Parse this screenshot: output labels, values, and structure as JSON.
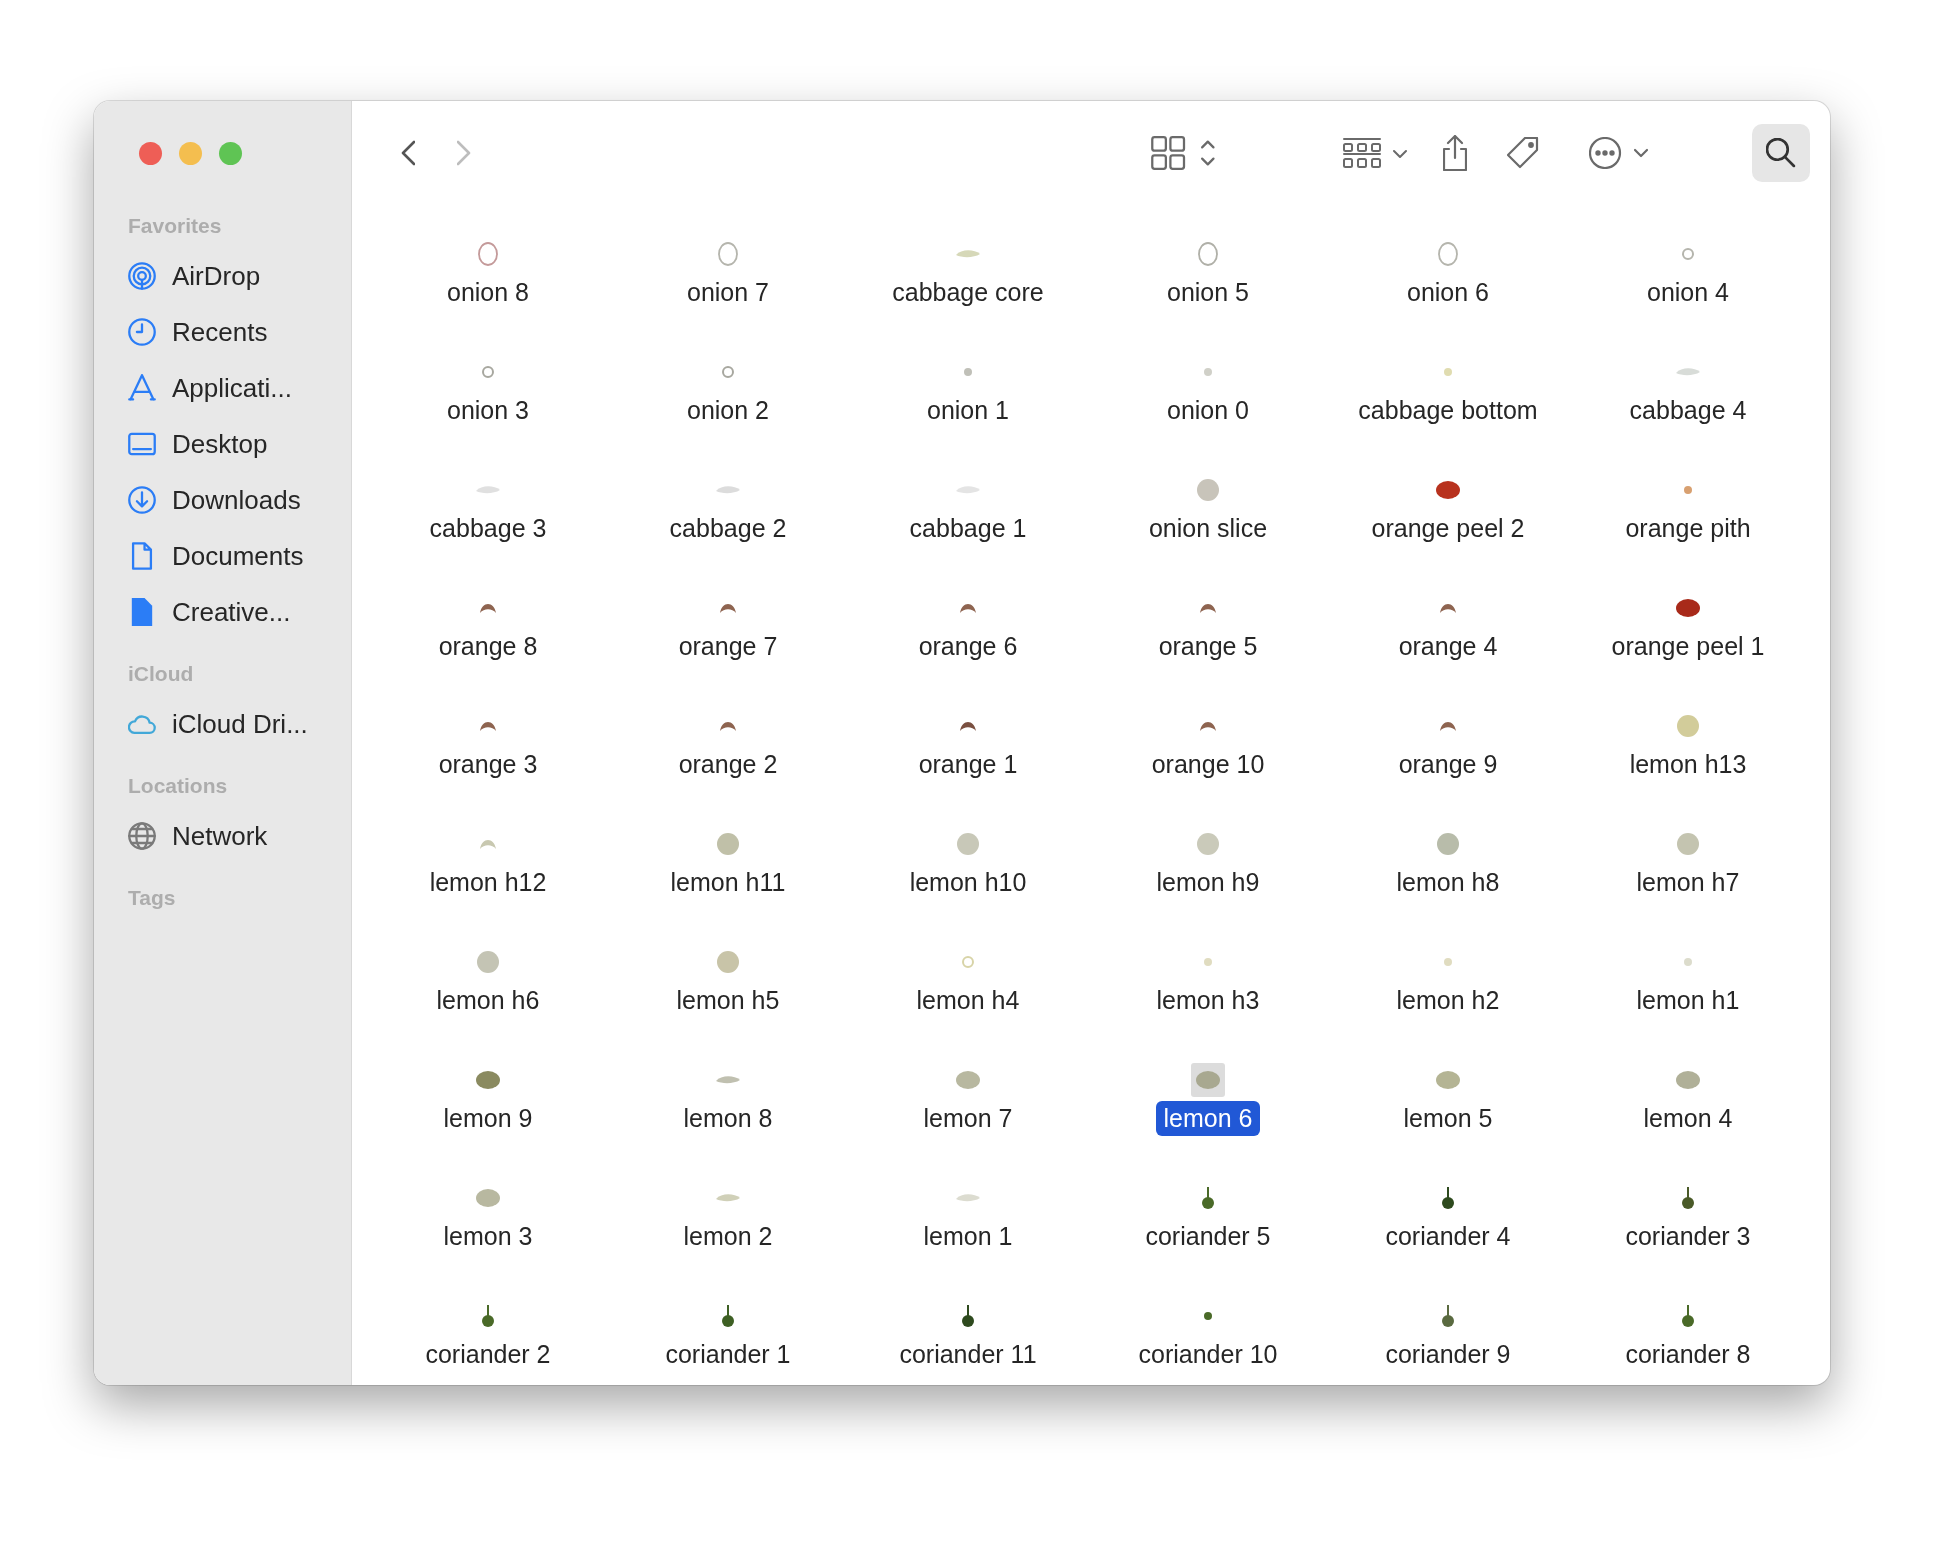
{
  "toolbar": {
    "back": {
      "disabled": false
    },
    "forward": {
      "disabled": true
    }
  },
  "sidebar": {
    "sections": [
      {
        "title": "Favorites",
        "items": [
          {
            "label": "AirDrop",
            "kind": "airdrop"
          },
          {
            "label": "Recents",
            "kind": "clock"
          },
          {
            "label": "Applicati...",
            "kind": "apps"
          },
          {
            "label": "Desktop",
            "kind": "desktop"
          },
          {
            "label": "Downloads",
            "kind": "download"
          },
          {
            "label": "Documents",
            "kind": "document"
          },
          {
            "label": "Creative...",
            "kind": "filled"
          }
        ]
      },
      {
        "title": "iCloud",
        "items": [
          {
            "label": "iCloud Dri...",
            "kind": "cloud"
          }
        ]
      },
      {
        "title": "Locations",
        "items": [
          {
            "label": "Network",
            "kind": "globe"
          }
        ]
      },
      {
        "title": "Tags"
      }
    ]
  },
  "files": [
    {
      "name": "onion 8",
      "kind": "ring",
      "color": "#c49a9a",
      "selected": false
    },
    {
      "name": "onion 7",
      "kind": "ring",
      "color": "#b5b5ad",
      "selected": false
    },
    {
      "name": "cabbage core",
      "kind": "sliver",
      "color": "#d6d8b8",
      "selected": false
    },
    {
      "name": "onion 5",
      "kind": "ring",
      "color": "#b0b0a8",
      "selected": false
    },
    {
      "name": "onion 6",
      "kind": "ring",
      "color": "#b5b5ad",
      "selected": false
    },
    {
      "name": "onion 4",
      "kind": "small",
      "color": "#b5b5ad",
      "selected": false
    },
    {
      "name": "onion 3",
      "kind": "small",
      "color": "#a8a8a0",
      "selected": false
    },
    {
      "name": "onion 2",
      "kind": "small",
      "color": "#a8a8a0",
      "selected": false
    },
    {
      "name": "onion 1",
      "kind": "dot",
      "color": "#c0c0b8",
      "selected": false
    },
    {
      "name": "onion 0",
      "kind": "dot",
      "color": "#d0d0c8",
      "selected": false
    },
    {
      "name": "cabbage bottom",
      "kind": "dot",
      "color": "#e0dcb0",
      "selected": false
    },
    {
      "name": "cabbage 4",
      "kind": "sliver",
      "color": "#d8dcd8",
      "selected": false
    },
    {
      "name": "cabbage 3",
      "kind": "sliver",
      "color": "#e0e0e0",
      "selected": false
    },
    {
      "name": "cabbage 2",
      "kind": "sliver",
      "color": "#dcdcdc",
      "selected": false
    },
    {
      "name": "cabbage 1",
      "kind": "sliver",
      "color": "#e4e4e4",
      "selected": false
    },
    {
      "name": "onion slice",
      "kind": "disc",
      "color": "#c8c4ba",
      "selected": false
    },
    {
      "name": "orange peel 2",
      "kind": "blob",
      "color": "#b8321e",
      "selected": false
    },
    {
      "name": "orange pith",
      "kind": "dot",
      "color": "#d8a070",
      "selected": false
    },
    {
      "name": "orange 8",
      "kind": "arc",
      "color": "#8e6450",
      "selected": false
    },
    {
      "name": "orange 7",
      "kind": "arc",
      "color": "#8e6450",
      "selected": false
    },
    {
      "name": "orange 6",
      "kind": "arc",
      "color": "#8e6450",
      "selected": false
    },
    {
      "name": "orange 5",
      "kind": "arc",
      "color": "#8e6450",
      "selected": false
    },
    {
      "name": "orange 4",
      "kind": "arc",
      "color": "#8e6450",
      "selected": false
    },
    {
      "name": "orange peel 1",
      "kind": "blob",
      "color": "#a82a1a",
      "selected": false
    },
    {
      "name": "orange 3",
      "kind": "arc",
      "color": "#8e6450",
      "selected": false
    },
    {
      "name": "orange 2",
      "kind": "arc",
      "color": "#8e6450",
      "selected": false
    },
    {
      "name": "orange 1",
      "kind": "arc",
      "color": "#7a5040",
      "selected": false
    },
    {
      "name": "orange 10",
      "kind": "arc",
      "color": "#8e6450",
      "selected": false
    },
    {
      "name": "orange 9",
      "kind": "arc",
      "color": "#8e6450",
      "selected": false
    },
    {
      "name": "lemon h13",
      "kind": "disc",
      "color": "#d2cc9a",
      "selected": false
    },
    {
      "name": "lemon h12",
      "kind": "arc",
      "color": "#c8c8b0",
      "selected": false
    },
    {
      "name": "lemon h11",
      "kind": "disc",
      "color": "#c0c0a8",
      "selected": false
    },
    {
      "name": "lemon h10",
      "kind": "disc",
      "color": "#c8c8b8",
      "selected": false
    },
    {
      "name": "lemon h9",
      "kind": "disc",
      "color": "#cacaba",
      "selected": false
    },
    {
      "name": "lemon h8",
      "kind": "disc",
      "color": "#b8bcaa",
      "selected": false
    },
    {
      "name": "lemon h7",
      "kind": "disc",
      "color": "#c4c4b0",
      "selected": false
    },
    {
      "name": "lemon h6",
      "kind": "disc",
      "color": "#c4c4b4",
      "selected": false
    },
    {
      "name": "lemon h5",
      "kind": "disc",
      "color": "#c8c4a8",
      "selected": false
    },
    {
      "name": "lemon h4",
      "kind": "small",
      "color": "#d8d4a8",
      "selected": false
    },
    {
      "name": "lemon h3",
      "kind": "dot",
      "color": "#e0dcc0",
      "selected": false
    },
    {
      "name": "lemon h2",
      "kind": "dot",
      "color": "#e0dcc0",
      "selected": false
    },
    {
      "name": "lemon h1",
      "kind": "dot",
      "color": "#dcdccc",
      "selected": false
    },
    {
      "name": "lemon 9",
      "kind": "blob",
      "color": "#8a8a60",
      "selected": false
    },
    {
      "name": "lemon 8",
      "kind": "sliver",
      "color": "#c0c0b0",
      "selected": false
    },
    {
      "name": "lemon 7",
      "kind": "blob",
      "color": "#b8b8a0",
      "selected": false
    },
    {
      "name": "lemon 6",
      "kind": "blob",
      "color": "#a8a890",
      "selected": true
    },
    {
      "name": "lemon 5",
      "kind": "blob",
      "color": "#b4b494",
      "selected": false
    },
    {
      "name": "lemon 4",
      "kind": "blob",
      "color": "#b0b098",
      "selected": false
    },
    {
      "name": "lemon 3",
      "kind": "blob",
      "color": "#b8b8a0",
      "selected": false
    },
    {
      "name": "lemon 2",
      "kind": "sliver",
      "color": "#d0d0b8",
      "selected": false
    },
    {
      "name": "lemon 1",
      "kind": "sliver",
      "color": "#dcdcd0",
      "selected": false
    },
    {
      "name": "coriander 5",
      "kind": "sprig",
      "color": "#4a6a28",
      "selected": false
    },
    {
      "name": "coriander 4",
      "kind": "sprig",
      "color": "#2e4a1e",
      "selected": false
    },
    {
      "name": "coriander 3",
      "kind": "sprig",
      "color": "#4a5a28",
      "selected": false
    },
    {
      "name": "coriander 2",
      "kind": "sprig",
      "color": "#4a6a28",
      "selected": false
    },
    {
      "name": "coriander 1",
      "kind": "sprig",
      "color": "#3e6024",
      "selected": false
    },
    {
      "name": "coriander 11",
      "kind": "sprig",
      "color": "#2e4a1e",
      "selected": false
    },
    {
      "name": "coriander 10",
      "kind": "dot",
      "color": "#4a6a28",
      "selected": false
    },
    {
      "name": "coriander 9",
      "kind": "sprig",
      "color": "#5a6a40",
      "selected": false
    },
    {
      "name": "coriander 8",
      "kind": "sprig",
      "color": "#4a6a28",
      "selected": false
    }
  ]
}
